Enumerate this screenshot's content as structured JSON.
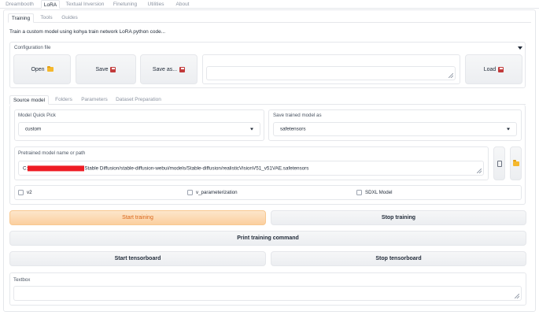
{
  "top_tabs": [
    "Dreambooth",
    "LoRA",
    "Textual Inversion",
    "Finetuning",
    "Utilities",
    "About"
  ],
  "sub_tabs": [
    "Training",
    "Tools",
    "Guides"
  ],
  "description": "Train a custom model using kohya train network LoRA python code...",
  "config": {
    "label": "Configuration file",
    "open_label": "Open",
    "save_label": "Save",
    "save_as_label": "Save as...",
    "path_value": "",
    "load_label": "Load"
  },
  "section_tabs": [
    "Source model",
    "Folders",
    "Parameters",
    "Dataset Preparation"
  ],
  "source_model": {
    "quick_pick_label": "Model Quick Pick",
    "quick_pick_value": "custom",
    "save_as_label": "Save trained model as",
    "save_as_value": "safetensors",
    "pretrained_label": "Pretrained model name or path",
    "pretrained_prefix": "C:",
    "pretrained_suffix": "Stable Diffusion/stable-diffusion-webui/models/Stable-diffusion/realisticVisionV51_v51VAE.safetensors",
    "check_v2": "v2",
    "check_vparam": "v_parameterization",
    "check_sdxl": "SDXL Model"
  },
  "actions": {
    "start_training": "Start training",
    "stop_training": "Stop training",
    "print_command": "Print training command",
    "start_tensorboard": "Start tensorboard",
    "stop_tensorboard": "Stop tensorboard"
  },
  "textbox": {
    "label": "Textbox",
    "value": ""
  }
}
